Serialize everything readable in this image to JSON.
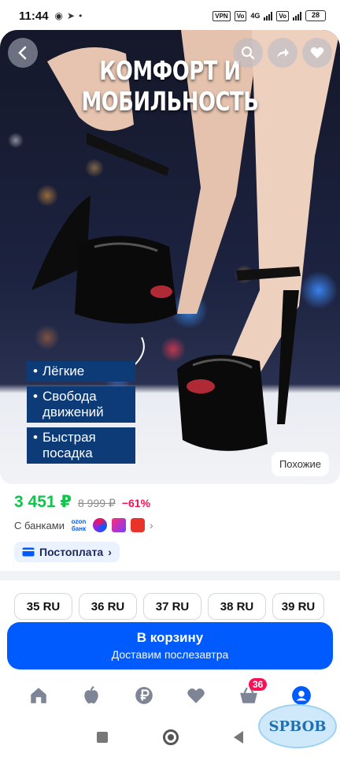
{
  "status_bar": {
    "time": "11:44",
    "vpn": "VPN",
    "network": "4G",
    "battery": "28"
  },
  "hero": {
    "title": "КОМФОРТ И МОБИЛЬНОСТЬ",
    "features": [
      "Лёгкие",
      "Свобода движений",
      "Быстрая посадка"
    ],
    "similar_label": "Похожие"
  },
  "price": {
    "current": "3 451 ₽",
    "old": "8 999 ₽",
    "discount": "−61%",
    "banks_label": "С банками",
    "ozon_bank_logo": "ozon банк",
    "postpay_label": "Постоплата"
  },
  "sizes": [
    "35 RU",
    "36 RU",
    "37 RU",
    "38 RU",
    "39 RU"
  ],
  "cart": {
    "title": "В корзину",
    "subtitle": "Доставим послезавтра"
  },
  "bottom_nav": {
    "cart_badge": "36"
  },
  "colors": {
    "brand_blue": "#005bff",
    "price_green": "#10c44c",
    "discount_pink": "#f91155"
  },
  "watermark": "SPBOB"
}
